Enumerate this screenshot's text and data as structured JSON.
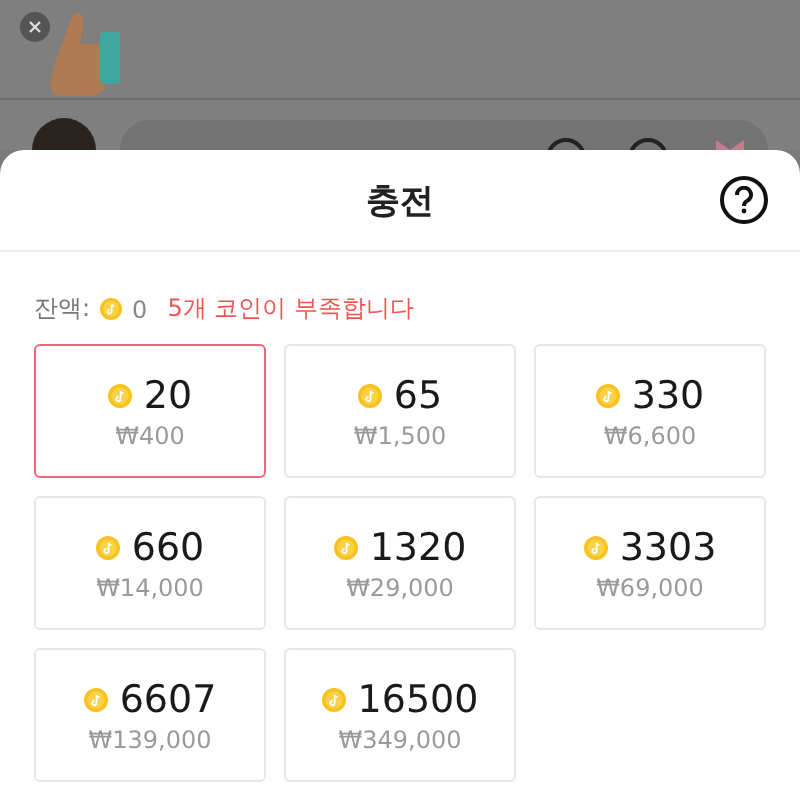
{
  "sheet": {
    "title": "충전"
  },
  "balance": {
    "label": "잔액:",
    "amount": "0",
    "warning": "5개 코인이 부족합니다"
  },
  "packages": [
    {
      "coins": "20",
      "price": "₩400",
      "selected": true
    },
    {
      "coins": "65",
      "price": "₩1,500",
      "selected": false
    },
    {
      "coins": "330",
      "price": "₩6,600",
      "selected": false
    },
    {
      "coins": "660",
      "price": "₩14,000",
      "selected": false
    },
    {
      "coins": "1320",
      "price": "₩29,000",
      "selected": false
    },
    {
      "coins": "3303",
      "price": "₩69,000",
      "selected": false
    },
    {
      "coins": "6607",
      "price": "₩139,000",
      "selected": false
    },
    {
      "coins": "16500",
      "price": "₩349,000",
      "selected": false
    }
  ]
}
